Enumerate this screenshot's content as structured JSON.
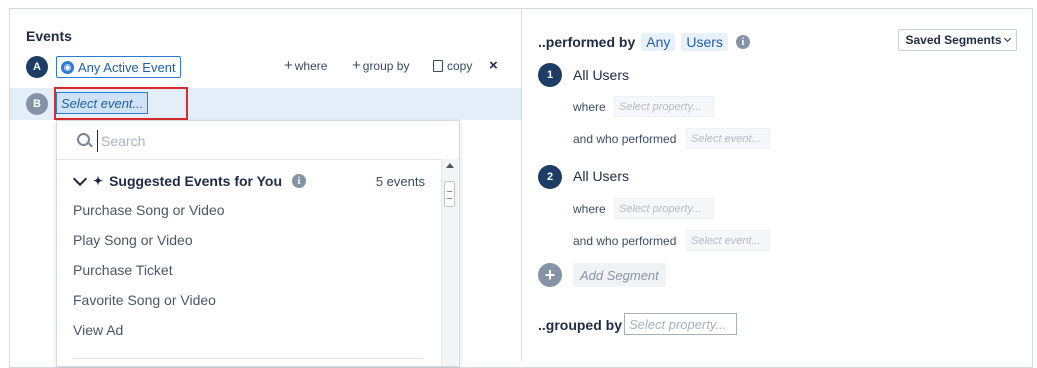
{
  "events_panel": {
    "title": "Events",
    "row_a": {
      "badge": "A",
      "event_label": "Any Active Event",
      "actions": {
        "where": "where",
        "group_by": "group by",
        "copy": "copy",
        "close": "×"
      }
    },
    "row_b": {
      "badge": "B",
      "event_placeholder": "Select event..."
    }
  },
  "dropdown": {
    "search_placeholder": "Search",
    "group": {
      "title": "Suggested Events for You",
      "count": "5 events",
      "items": [
        "Purchase Song or Video",
        "Play Song or Video",
        "Purchase Ticket",
        "Favorite Song or Video",
        "View Ad"
      ]
    }
  },
  "segments_panel": {
    "title": "..performed by",
    "any_label": "Any",
    "users_label": "Users",
    "saved_segments_label": "Saved Segments",
    "segments": [
      {
        "number": "1",
        "name": "All Users",
        "where_label": "where",
        "where_placeholder": "Select property...",
        "performed_label": "and who performed",
        "performed_placeholder": "Select event..."
      },
      {
        "number": "2",
        "name": "All Users",
        "where_label": "where",
        "where_placeholder": "Select property...",
        "performed_label": "and who performed",
        "performed_placeholder": "Select event..."
      }
    ],
    "add_segment_label": "Add Segment",
    "grouped_by_title": "..grouped by",
    "grouped_by_placeholder": "Select property..."
  },
  "colors": {
    "accent": "#2a7bd3",
    "navy": "#1d3c66",
    "highlight": "#d92b2b",
    "row_selected": "#e3eef9"
  }
}
